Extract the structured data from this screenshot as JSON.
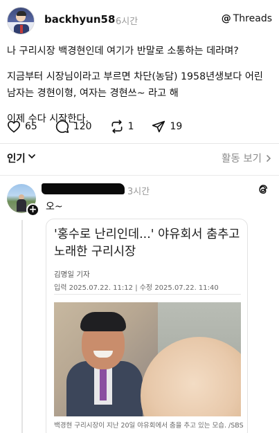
{
  "post": {
    "username": "backhyun58",
    "time": "6시간",
    "threads_label": "Threads",
    "lines": [
      "나 구리시장 백경현인데 여기가 반말로 소통하는 데라며?",
      "지금부터 시장님이라고 부르면 차단(농담) 1958년생보다 어린 남자는 경현이형, 여자는 경현쓰~ 라고 해",
      "이제 수다 시작한다."
    ],
    "likes": "65",
    "comments": "120",
    "reposts": "1",
    "shares": "19"
  },
  "sort_bar": {
    "label": "인기",
    "activity": "활동 보기"
  },
  "reply": {
    "time": "3시간",
    "text": "오~"
  },
  "article": {
    "title": "'홍수로 난리인데...' 야유회서 춤추고 노래한 구리시장",
    "author": "김명일 기자",
    "dates": "입력 2025.07.22. 11:12 | 수정 2025.07.22. 11:40",
    "caption": "백경현 구리시장이 지난 20일 야유회에서 춤을 추고 있는 모습. /SBS"
  },
  "icons": {
    "like": "heart-icon",
    "comment": "comment-icon",
    "repost": "repost-icon",
    "share": "send-icon",
    "threads": "threads-logo-icon"
  }
}
